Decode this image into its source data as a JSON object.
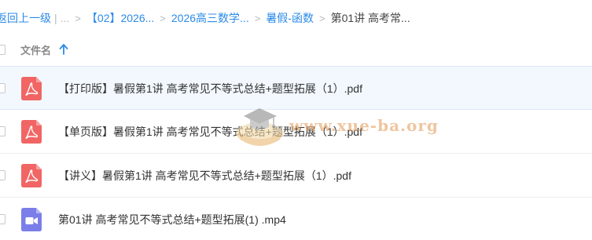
{
  "breadcrumb": {
    "back": "返回上一级",
    "divider": "|",
    "ellipsis": "...",
    "sep": ">",
    "items": [
      "【02】2026...",
      "2026高三数学...",
      "暑假-函数"
    ],
    "current": "第01讲 高考常..."
  },
  "table": {
    "column_label": "文件名"
  },
  "files": [
    {
      "name": "【打印版】暑假第1讲 高考常见不等式总结+题型拓展（1）.pdf",
      "icon": "pdf-icon"
    },
    {
      "name": "【单页版】暑假第1讲 高考常见不等式总结+题型拓展（1）.pdf",
      "icon": "pdf-icon"
    },
    {
      "name": "【讲义】暑假第1讲 高考常见不等式总结+题型拓展（1）.pdf",
      "icon": "pdf-icon"
    },
    {
      "name": "第01讲 高考常见不等式总结+题型拓展(1) .mp4",
      "icon": "video-icon"
    }
  ],
  "watermark": {
    "text": "www.xue-ba.org"
  },
  "colors": {
    "link": "#2b8ae8",
    "pdf": "#f16565",
    "video": "#7b7ee8",
    "selected_row": "#f2f8fe"
  }
}
